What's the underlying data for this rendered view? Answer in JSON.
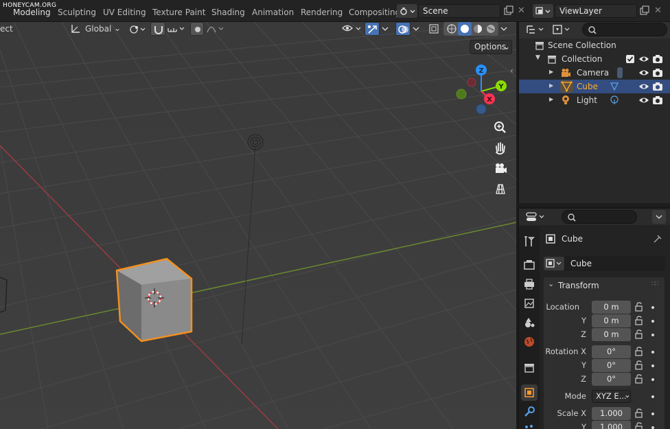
{
  "watermark": "HONEYCAM.ORG",
  "topbar": {
    "tabs": [
      "Modeling",
      "Sculpting",
      "UV Editing",
      "Texture Paint",
      "Shading",
      "Animation",
      "Rendering",
      "Compositing"
    ],
    "scene": "Scene",
    "view_layer": "ViewLayer"
  },
  "viewport_header": {
    "mode_fragment": "ect",
    "orientation": "Global",
    "options_label": "Options"
  },
  "gizmo": {
    "z": "Z",
    "y": "Y",
    "x": "X"
  },
  "outliner": {
    "scene_collection": "Scene Collection",
    "collection": "Collection",
    "items": [
      "Camera",
      "Cube",
      "Light"
    ],
    "selected": "Cube"
  },
  "properties": {
    "object_name": "Cube",
    "data_name": "Cube",
    "panel_title": "Transform",
    "location_label": "Location",
    "rotation_label": "Rotation X",
    "mode_label": "Mode",
    "scale_label": "Scale X",
    "axis_y": "Y",
    "axis_z": "Z",
    "location": [
      "0 m",
      "0 m",
      "0 m"
    ],
    "rotation": [
      "0°",
      "0°",
      "0°"
    ],
    "mode_value": "XYZ E...",
    "scale": [
      "1.000",
      "1.000"
    ]
  },
  "colors": {
    "accent_blue": "#4772b3",
    "selection_orange": "#ffaf29",
    "x_axis": "#ff3352",
    "y_axis": "#8bdc00",
    "z_axis": "#2890ff"
  }
}
